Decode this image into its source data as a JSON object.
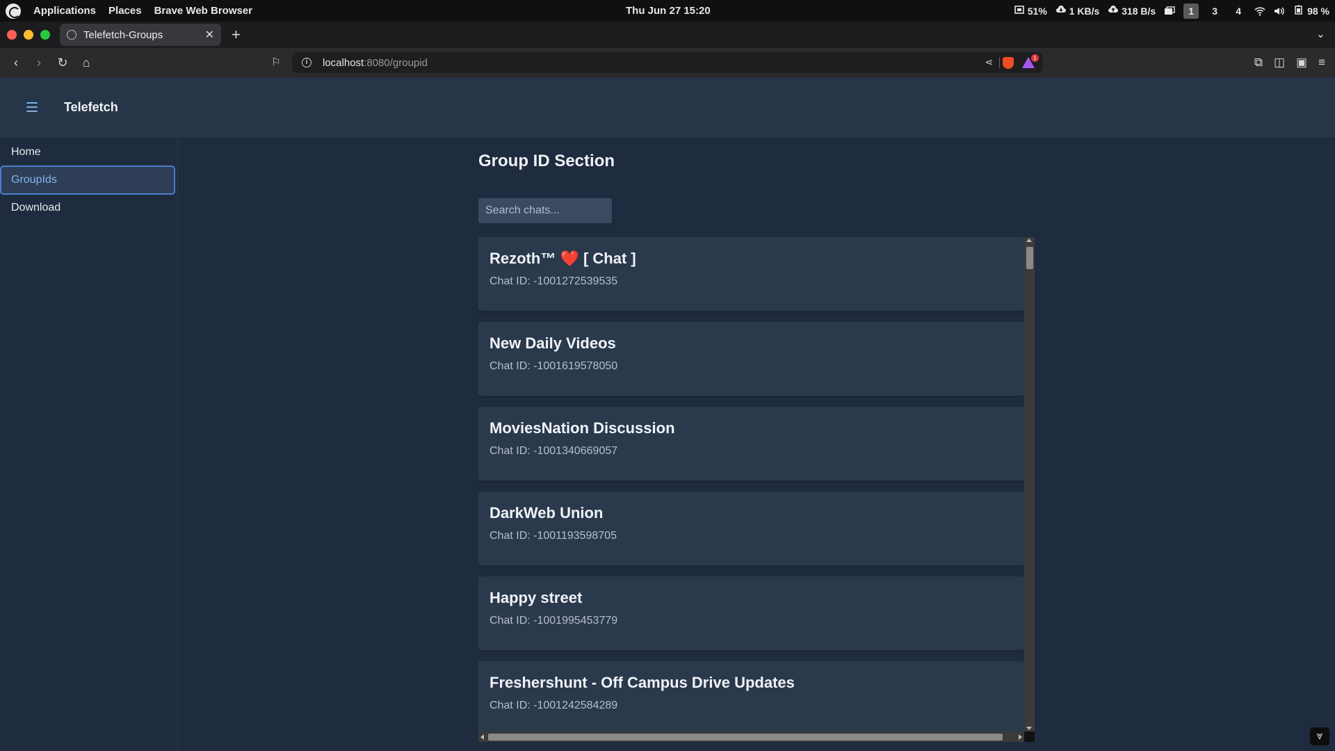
{
  "os": {
    "menus": [
      "Applications",
      "Places",
      "Brave Web Browser"
    ],
    "clock": "Thu Jun 27  15:20",
    "cpu": "51%",
    "net_down": "1 KB/s",
    "net_up": "318 B/s",
    "workspaces": [
      "1",
      "3",
      "4"
    ],
    "active_workspace": "1",
    "battery": "98 %",
    "icons": [
      "debian-logo-icon",
      "cpu-icon",
      "download-cloud-icon",
      "upload-cloud-icon",
      "screenshot-icon",
      "wifi-icon",
      "volume-icon",
      "battery-icon"
    ]
  },
  "browser": {
    "tab_title": "Telefetch-Groups",
    "url_host": "localhost",
    "url_path": ":8080/groupid",
    "rewards_badge": "1",
    "colors": {
      "close": "#ff5f57",
      "minimize": "#febc2e",
      "maximize": "#28c840"
    }
  },
  "app": {
    "title": "Telefetch",
    "accent": "#4a7fd0",
    "sidebar": {
      "items": [
        {
          "label": "Home",
          "active": false
        },
        {
          "label": "GroupIds",
          "active": true
        },
        {
          "label": "Download",
          "active": false
        }
      ]
    },
    "main": {
      "section_title": "Group ID Section",
      "search_placeholder": "Search chats...",
      "chat_id_prefix": "Chat ID: ",
      "chats": [
        {
          "name": "Rezoth™ ❤️ [ Chat ]",
          "id": "-1001272539535"
        },
        {
          "name": "New Daily Videos",
          "id": "-1001619578050"
        },
        {
          "name": "MoviesNation Discussion",
          "id": "-1001340669057"
        },
        {
          "name": "DarkWeb Union",
          "id": "-1001193598705"
        },
        {
          "name": "Happy street",
          "id": "-1001995453779"
        },
        {
          "name": "Freshershunt - Off Campus Drive Updates",
          "id": "-1001242584289"
        }
      ]
    }
  }
}
